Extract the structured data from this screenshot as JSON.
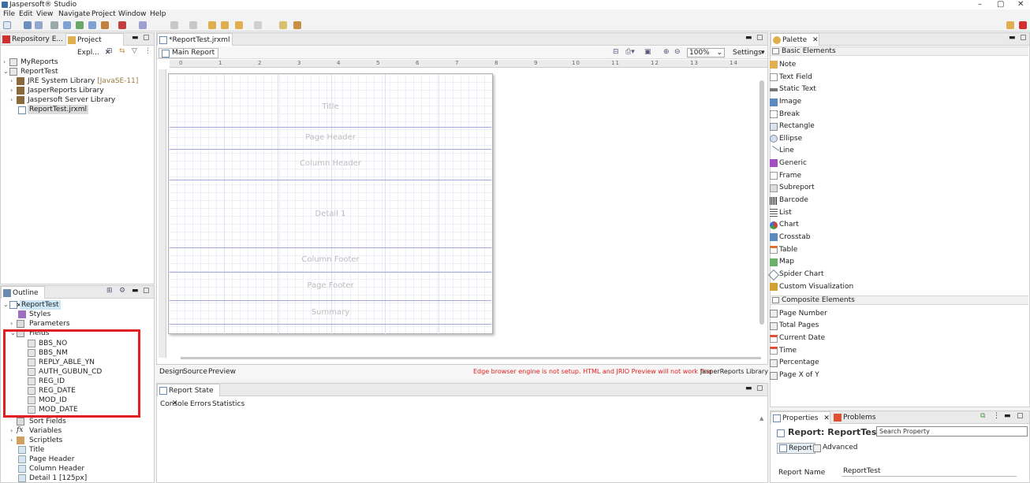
{
  "app": {
    "title": "Jaspersoft® Studio",
    "win_min": "–",
    "win_max": "▢",
    "win_close": "✕"
  },
  "menu": [
    "File",
    "Edit",
    "View",
    "Navigate",
    "Project",
    "Window",
    "Help"
  ],
  "left_tabs": {
    "repo": "Repository E...",
    "project": "Project Expl..."
  },
  "project_tree": {
    "myreports": "MyReports",
    "reporttest": "ReportTest",
    "jre": "JRE System Library",
    "jre_tag": "[JavaSE-11]",
    "jasperlib": "JasperReports Library",
    "serverlib": "Jaspersoft Server Library",
    "file": "ReportTest.jrxml"
  },
  "editor": {
    "tab": "*ReportTest.jrxml",
    "subtab": "Main Report",
    "zoom": "100%",
    "settings": "Settings",
    "ruler_numbers": [
      "1",
      "2",
      "3",
      "4",
      "5",
      "6",
      "7",
      "8",
      "9",
      "10",
      "11",
      "12",
      "13",
      "14"
    ],
    "bands": [
      "Title",
      "Page Header",
      "Column Header",
      "Detail 1",
      "Column Footer",
      "Page Footer",
      "Summary"
    ],
    "bottom_tabs": [
      "Design",
      "Source",
      "Preview"
    ],
    "warning": "Edge browser engine is not setup. HTML and JRIO Preview will not work fine",
    "lib_button": "JasperReports Library"
  },
  "outline": {
    "title": "Outline",
    "root": "ReportTest",
    "styles": "Styles",
    "parameters": "Parameters",
    "fields": "Fields",
    "field_items": [
      "BBS_NO",
      "BBS_NM",
      "REPLY_ABLE_YN",
      "AUTH_GUBUN_CD",
      "REG_ID",
      "REG_DATE",
      "MOD_ID",
      "MOD_DATE"
    ],
    "sort_fields": "Sort Fields",
    "variables": "Variables",
    "scriptlets": "Scriptlets",
    "title_band": "Title",
    "page_header": "Page Header",
    "column_header": "Column Header",
    "detail": "Detail 1 [125px]"
  },
  "report_state": {
    "title": "Report State",
    "tabs": [
      "Console",
      "Errors",
      "Statistics"
    ]
  },
  "palette": {
    "title": "Palette",
    "basic_section": "Basic Elements",
    "basic": [
      "Note",
      "Text Field",
      "Static Text",
      "Image",
      "Break",
      "Rectangle",
      "Ellipse",
      "Line",
      "Generic",
      "Frame",
      "Subreport",
      "Barcode",
      "List",
      "Chart",
      "Crosstab",
      "Table",
      "Map",
      "Spider Chart",
      "Custom Visualization"
    ],
    "composite_section": "Composite Elements",
    "composite": [
      "Page Number",
      "Total Pages",
      "Current Date",
      "Time",
      "Percentage",
      "Page X of Y"
    ]
  },
  "properties": {
    "tab1": "Properties",
    "tab2": "Problems",
    "heading": "Report: ReportTest",
    "search_placeholder": "Search Property",
    "subtab_report": "Report",
    "subtab_advanced": "Advanced",
    "name_label": "Report Name",
    "name_value": "ReportTest"
  },
  "colors": {
    "highlight": "#e02020",
    "selection": "#cde6f7",
    "band_line": "#a8a8e0"
  }
}
